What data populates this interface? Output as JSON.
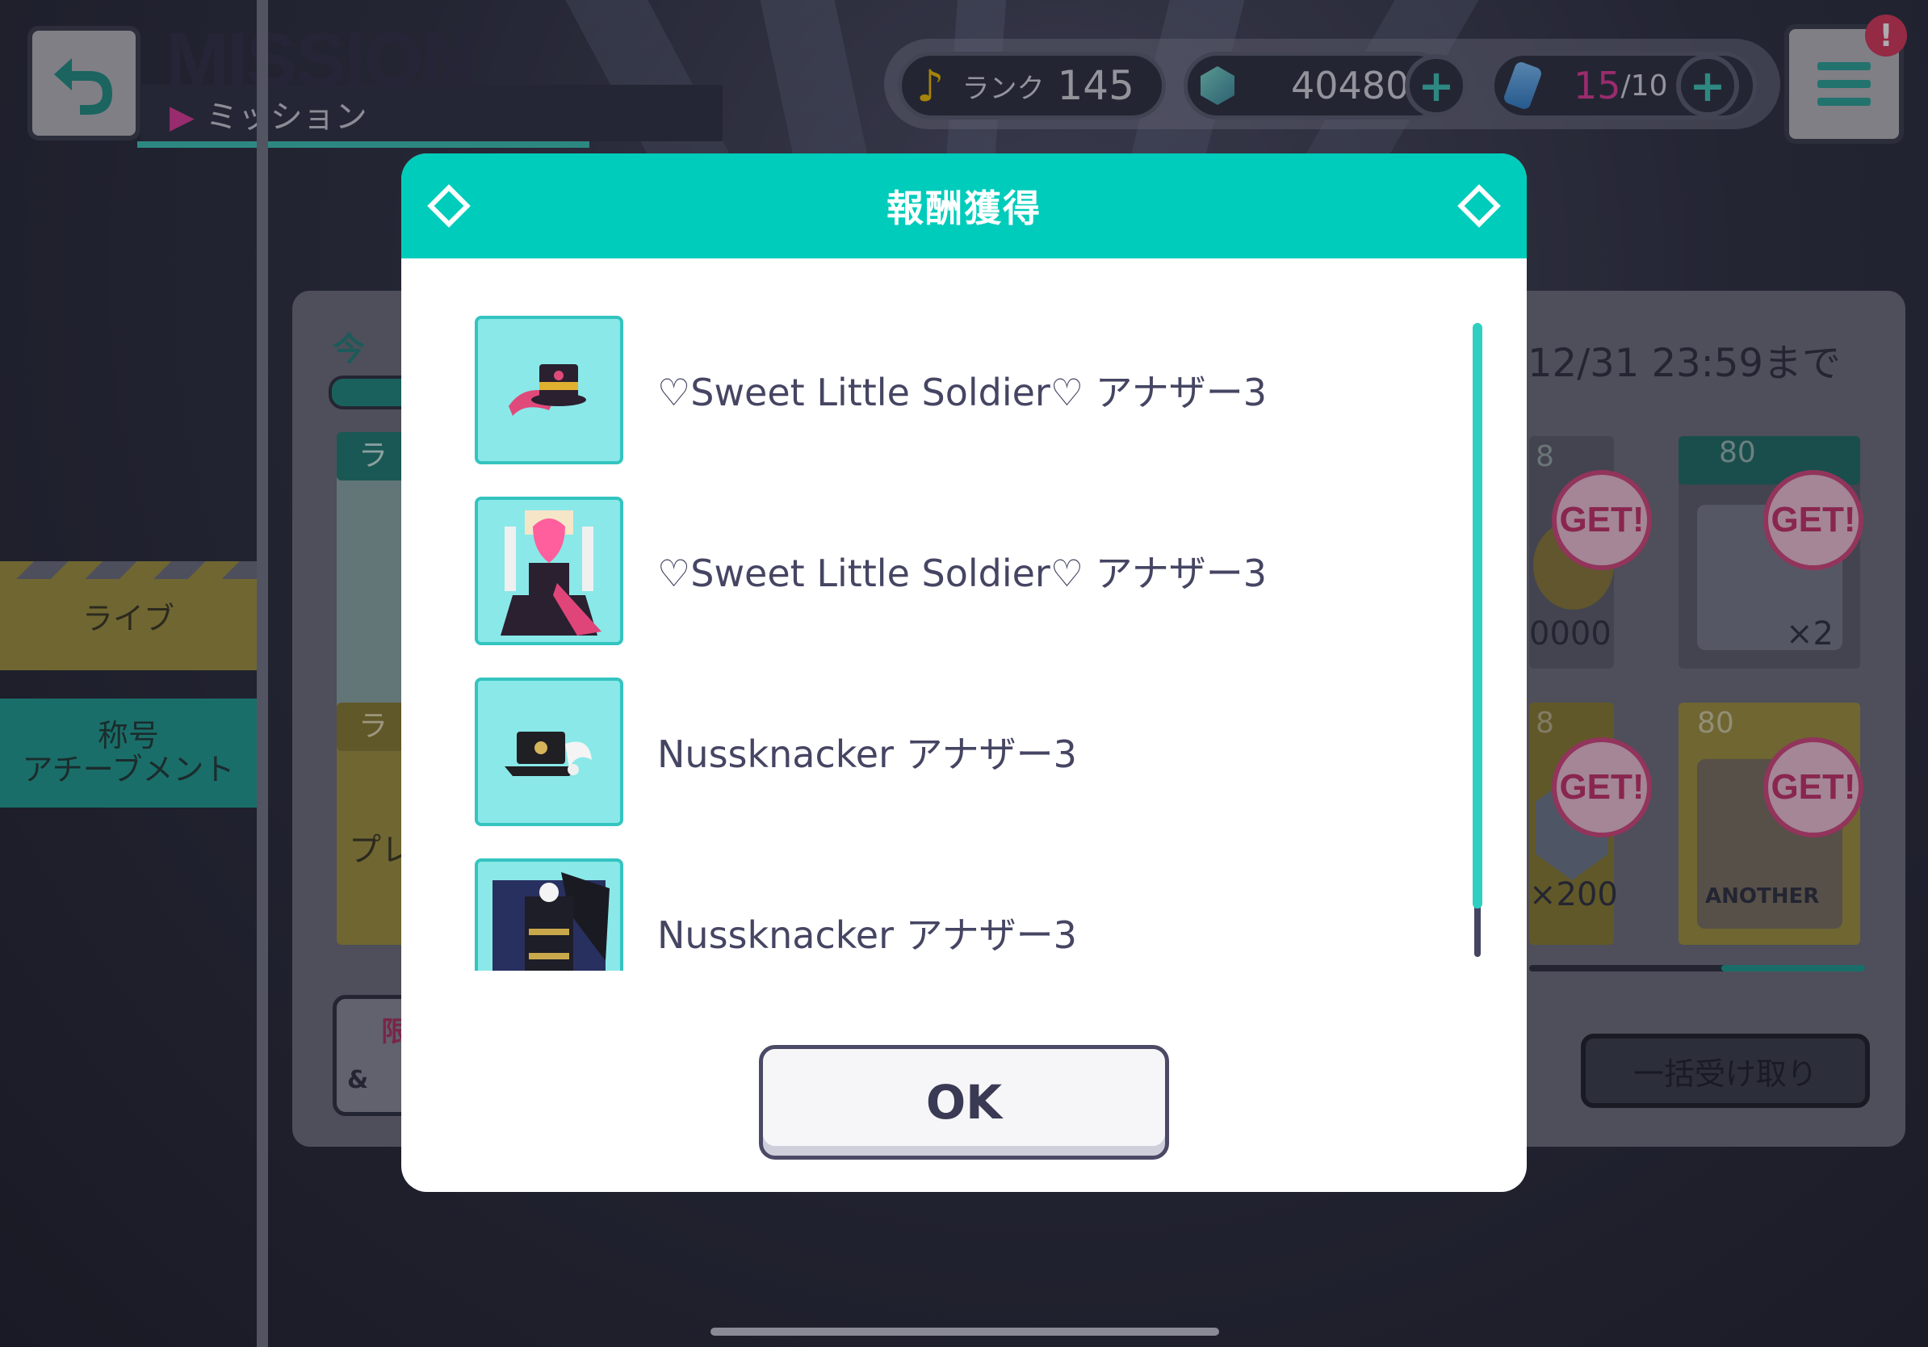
{
  "header": {
    "title": "MISSION",
    "subtitle": "ミッション",
    "rank_label": "ランク",
    "rank_value": "145",
    "gems": "40480",
    "stamina_current": "15",
    "stamina_max": "/10",
    "plus_symbol": "+",
    "alert_symbol": "!"
  },
  "sidebar": {
    "items": [
      {
        "label": "ライブ"
      },
      {
        "label_line1": "称号",
        "label_line2": "アチーブメント"
      }
    ]
  },
  "background_panel": {
    "deadline": "12/31 23:59まで",
    "claim_all_label": "一括受け取り",
    "get_badge": "GET!",
    "reward_counts": [
      "0000",
      "×2",
      "×200"
    ],
    "another_label": "ANOTHER",
    "partial_texts": [
      "今",
      "ラ",
      "ラ",
      "プレ",
      "限",
      "&",
      "8",
      "80",
      "8",
      "80"
    ]
  },
  "modal": {
    "title": "報酬獲得",
    "rewards": [
      {
        "label": "♡Sweet Little Soldier♡ アナザー3",
        "icon": "hat-icon"
      },
      {
        "label": "♡Sweet Little Soldier♡ アナザー3",
        "icon": "costume-icon"
      },
      {
        "label": "Nussknacker アナザー3",
        "icon": "hat-icon"
      },
      {
        "label": "Nussknacker アナザー3",
        "icon": "costume-icon"
      }
    ],
    "ok_label": "OK"
  },
  "colors": {
    "accent": "#00ccbb",
    "get_pink": "#d6457d",
    "live_tab": "#a0923e"
  }
}
